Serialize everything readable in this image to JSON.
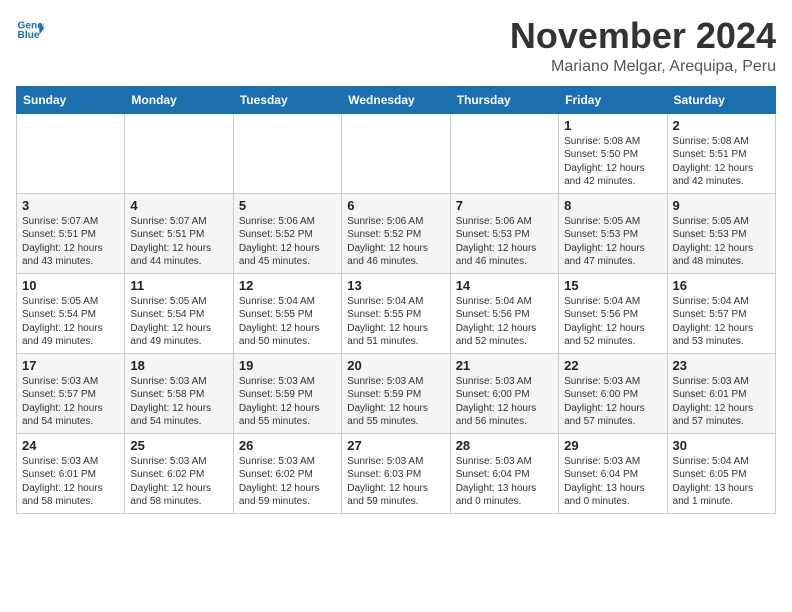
{
  "header": {
    "logo_line1": "General",
    "logo_line2": "Blue",
    "month": "November 2024",
    "location": "Mariano Melgar, Arequipa, Peru"
  },
  "weekdays": [
    "Sunday",
    "Monday",
    "Tuesday",
    "Wednesday",
    "Thursday",
    "Friday",
    "Saturday"
  ],
  "weeks": [
    [
      {
        "day": "",
        "info": ""
      },
      {
        "day": "",
        "info": ""
      },
      {
        "day": "",
        "info": ""
      },
      {
        "day": "",
        "info": ""
      },
      {
        "day": "",
        "info": ""
      },
      {
        "day": "1",
        "info": "Sunrise: 5:08 AM\nSunset: 5:50 PM\nDaylight: 12 hours\nand 42 minutes."
      },
      {
        "day": "2",
        "info": "Sunrise: 5:08 AM\nSunset: 5:51 PM\nDaylight: 12 hours\nand 42 minutes."
      }
    ],
    [
      {
        "day": "3",
        "info": "Sunrise: 5:07 AM\nSunset: 5:51 PM\nDaylight: 12 hours\nand 43 minutes."
      },
      {
        "day": "4",
        "info": "Sunrise: 5:07 AM\nSunset: 5:51 PM\nDaylight: 12 hours\nand 44 minutes."
      },
      {
        "day": "5",
        "info": "Sunrise: 5:06 AM\nSunset: 5:52 PM\nDaylight: 12 hours\nand 45 minutes."
      },
      {
        "day": "6",
        "info": "Sunrise: 5:06 AM\nSunset: 5:52 PM\nDaylight: 12 hours\nand 46 minutes."
      },
      {
        "day": "7",
        "info": "Sunrise: 5:06 AM\nSunset: 5:53 PM\nDaylight: 12 hours\nand 46 minutes."
      },
      {
        "day": "8",
        "info": "Sunrise: 5:05 AM\nSunset: 5:53 PM\nDaylight: 12 hours\nand 47 minutes."
      },
      {
        "day": "9",
        "info": "Sunrise: 5:05 AM\nSunset: 5:53 PM\nDaylight: 12 hours\nand 48 minutes."
      }
    ],
    [
      {
        "day": "10",
        "info": "Sunrise: 5:05 AM\nSunset: 5:54 PM\nDaylight: 12 hours\nand 49 minutes."
      },
      {
        "day": "11",
        "info": "Sunrise: 5:05 AM\nSunset: 5:54 PM\nDaylight: 12 hours\nand 49 minutes."
      },
      {
        "day": "12",
        "info": "Sunrise: 5:04 AM\nSunset: 5:55 PM\nDaylight: 12 hours\nand 50 minutes."
      },
      {
        "day": "13",
        "info": "Sunrise: 5:04 AM\nSunset: 5:55 PM\nDaylight: 12 hours\nand 51 minutes."
      },
      {
        "day": "14",
        "info": "Sunrise: 5:04 AM\nSunset: 5:56 PM\nDaylight: 12 hours\nand 52 minutes."
      },
      {
        "day": "15",
        "info": "Sunrise: 5:04 AM\nSunset: 5:56 PM\nDaylight: 12 hours\nand 52 minutes."
      },
      {
        "day": "16",
        "info": "Sunrise: 5:04 AM\nSunset: 5:57 PM\nDaylight: 12 hours\nand 53 minutes."
      }
    ],
    [
      {
        "day": "17",
        "info": "Sunrise: 5:03 AM\nSunset: 5:57 PM\nDaylight: 12 hours\nand 54 minutes."
      },
      {
        "day": "18",
        "info": "Sunrise: 5:03 AM\nSunset: 5:58 PM\nDaylight: 12 hours\nand 54 minutes."
      },
      {
        "day": "19",
        "info": "Sunrise: 5:03 AM\nSunset: 5:59 PM\nDaylight: 12 hours\nand 55 minutes."
      },
      {
        "day": "20",
        "info": "Sunrise: 5:03 AM\nSunset: 5:59 PM\nDaylight: 12 hours\nand 55 minutes."
      },
      {
        "day": "21",
        "info": "Sunrise: 5:03 AM\nSunset: 6:00 PM\nDaylight: 12 hours\nand 56 minutes."
      },
      {
        "day": "22",
        "info": "Sunrise: 5:03 AM\nSunset: 6:00 PM\nDaylight: 12 hours\nand 57 minutes."
      },
      {
        "day": "23",
        "info": "Sunrise: 5:03 AM\nSunset: 6:01 PM\nDaylight: 12 hours\nand 57 minutes."
      }
    ],
    [
      {
        "day": "24",
        "info": "Sunrise: 5:03 AM\nSunset: 6:01 PM\nDaylight: 12 hours\nand 58 minutes."
      },
      {
        "day": "25",
        "info": "Sunrise: 5:03 AM\nSunset: 6:02 PM\nDaylight: 12 hours\nand 58 minutes."
      },
      {
        "day": "26",
        "info": "Sunrise: 5:03 AM\nSunset: 6:02 PM\nDaylight: 12 hours\nand 59 minutes."
      },
      {
        "day": "27",
        "info": "Sunrise: 5:03 AM\nSunset: 6:03 PM\nDaylight: 12 hours\nand 59 minutes."
      },
      {
        "day": "28",
        "info": "Sunrise: 5:03 AM\nSunset: 6:04 PM\nDaylight: 13 hours\nand 0 minutes."
      },
      {
        "day": "29",
        "info": "Sunrise: 5:03 AM\nSunset: 6:04 PM\nDaylight: 13 hours\nand 0 minutes."
      },
      {
        "day": "30",
        "info": "Sunrise: 5:04 AM\nSunset: 6:05 PM\nDaylight: 13 hours\nand 1 minute."
      }
    ]
  ]
}
